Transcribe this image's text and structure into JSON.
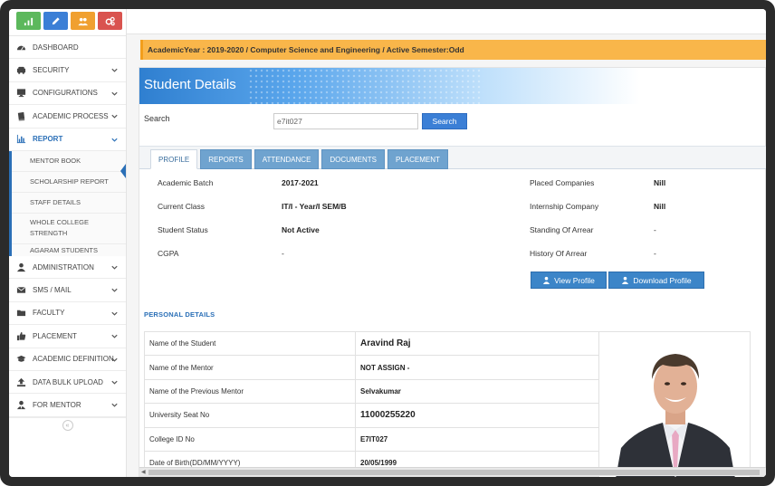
{
  "sidebar": {
    "top_buttons": [
      {
        "icon": "signal-icon",
        "color": "#5cb85c"
      },
      {
        "icon": "pencil-icon",
        "color": "#3b7fd6"
      },
      {
        "icon": "users-icon",
        "color": "#f0a030"
      },
      {
        "icon": "cogs-icon",
        "color": "#d9534f"
      }
    ],
    "items": [
      {
        "label": "DASHBOARD",
        "icon": "dashboard-icon"
      },
      {
        "label": "SECURITY",
        "icon": "car-icon"
      },
      {
        "label": "CONFIGURATIONS",
        "icon": "monitor-icon"
      },
      {
        "label": "ACADEMIC PROCESS",
        "icon": "book-icon"
      },
      {
        "label": "REPORT",
        "icon": "bar-chart-icon"
      },
      {
        "label": "ADMINISTRATION",
        "icon": "user-icon"
      },
      {
        "label": "SMS / MAIL",
        "icon": "envelope-icon"
      },
      {
        "label": "FACULTY",
        "icon": "folder-icon"
      },
      {
        "label": "PLACEMENT",
        "icon": "thumbs-up-icon"
      },
      {
        "label": "ACADEMIC DEFINITION",
        "icon": "graduation-cap-icon"
      },
      {
        "label": "DATA BULK UPLOAD",
        "icon": "upload-icon"
      },
      {
        "label": "FOR MENTOR",
        "icon": "user-tie-icon"
      }
    ],
    "report_submenu": [
      "MENTOR BOOK",
      "SCHOLARSHIP REPORT",
      "STAFF DETAILS",
      "WHOLE COLLEGE STRENGTH",
      "AGARAM STUDENTS"
    ],
    "collapse_symbol": "«"
  },
  "banner": {
    "text": "AcademicYear : 2019-2020 / Computer Science and Engineering / Active Semester:Odd"
  },
  "page": {
    "title": "Student Details",
    "search_label": "Search",
    "search_value": "e7it027",
    "search_button": "Search"
  },
  "tabs": [
    "PROFILE",
    "REPORTS",
    "ATTENDANCE",
    "DOCUMENTS",
    "PLACEMENT"
  ],
  "summary_left": [
    {
      "key": "Academic Batch",
      "value": "2017-2021"
    },
    {
      "key": "Current Class",
      "value": "IT/I - Year/I SEM/B"
    },
    {
      "key": "Student Status",
      "value": "Not Active"
    },
    {
      "key": "CGPA",
      "value": "-"
    }
  ],
  "summary_right": [
    {
      "key": "Placed Companies",
      "value": "Nill"
    },
    {
      "key": "Internship Company",
      "value": "Nill"
    },
    {
      "key": "Standing Of Arrear",
      "value": "-"
    },
    {
      "key": "History Of Arrear",
      "value": "-"
    }
  ],
  "profile_buttons": {
    "view": "View Profile",
    "download": "Download Profile"
  },
  "personal_details": {
    "title": "PERSONAL DETAILS",
    "rows": [
      {
        "key": "Name of the Student",
        "value": "Aravind Raj"
      },
      {
        "key": "Name of the Mentor",
        "value": "NOT ASSIGN -"
      },
      {
        "key": "Name of the Previous Mentor",
        "value": "Selvakumar"
      },
      {
        "key": "University Seat No",
        "value": "11000255220"
      },
      {
        "key": "College ID No",
        "value": "E7IT027"
      },
      {
        "key": "Date of Birth(DD/MM/YYYY)",
        "value": "20/05/1999"
      }
    ]
  },
  "colors": {
    "accent": "#2a6fb7",
    "banner": "#f9b64a",
    "tab": "#6fa3cf",
    "button": "#3c85c8"
  }
}
